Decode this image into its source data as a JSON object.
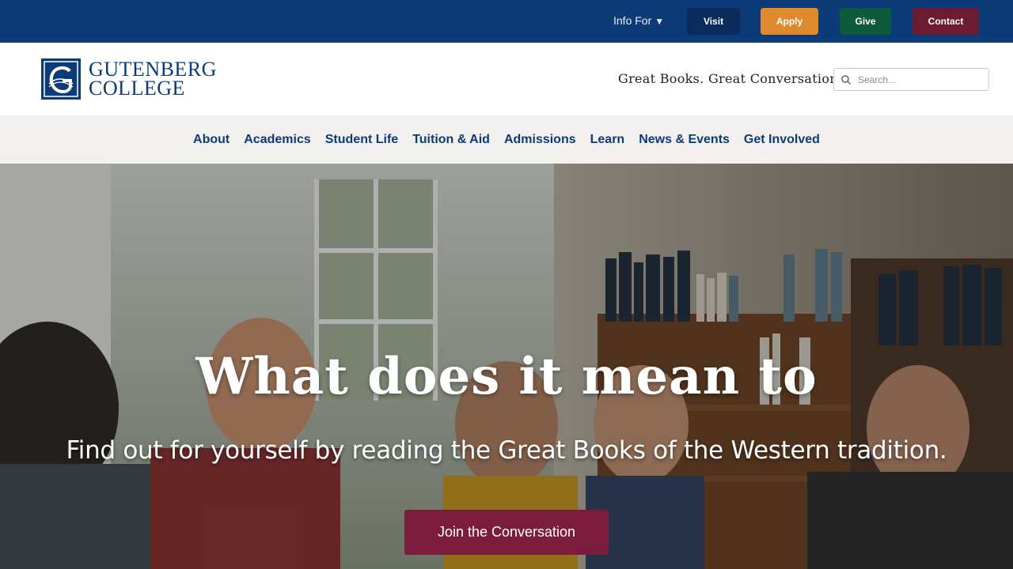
{
  "topbar": {
    "info_for": "Info For",
    "info_for_caret": "▼",
    "buttons": [
      {
        "label": "Visit",
        "color": "#0a2b5c"
      },
      {
        "label": "Apply",
        "color": "#e08a2e"
      },
      {
        "label": "Give",
        "color": "#0e5a3c"
      },
      {
        "label": "Contact",
        "color": "#6b1c33"
      }
    ],
    "background": "#0d3b78"
  },
  "header": {
    "logo": {
      "line1": "GUTENBERG",
      "line2": "COLLEGE",
      "icon": "gutenberg-g-seal-icon"
    },
    "tagline": "Great Books. Great Conversation.",
    "search": {
      "placeholder": "Search...",
      "value": "",
      "icon": "search-icon"
    }
  },
  "nav": {
    "items": [
      "About",
      "Academics",
      "Student Life",
      "Tuition & Aid",
      "Admissions",
      "Learn",
      "News & Events",
      "Get Involved"
    ]
  },
  "hero": {
    "title": "What does it mean to",
    "subtitle": "Find out for yourself by reading the Great Books of the Western tradition.",
    "cta": "Join the Conversation",
    "cta_color": "#7c1c3c"
  }
}
